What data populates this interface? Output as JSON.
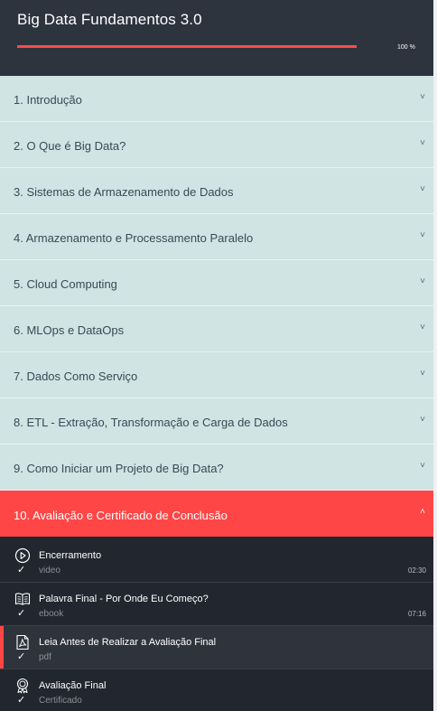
{
  "course": {
    "title": "Big Data Fundamentos 3.0",
    "progress_label": "100 %",
    "progress_fraction": 1.0
  },
  "sections": [
    {
      "label": "1. Introdução"
    },
    {
      "label": "2. O Que é Big Data?"
    },
    {
      "label": "3. Sistemas de Armazenamento de Dados"
    },
    {
      "label": "4. Armazenamento e Processamento Paralelo"
    },
    {
      "label": "5. Cloud Computing"
    },
    {
      "label": "6. MLOps e DataOps"
    },
    {
      "label": "7. Dados Como Serviço"
    },
    {
      "label": "8. ETL - Extração, Transformação e Carga de Dados"
    },
    {
      "label": "9. Como Iniciar um Projeto de Big Data?"
    },
    {
      "label": "10. Avaliação e Certificado de Conclusão"
    }
  ],
  "icons": {
    "chevron_down": "˅",
    "chevron_up": "˄",
    "check": "✓"
  },
  "lessons": [
    {
      "title": "Encerramento",
      "type": "video",
      "duration": "02:30",
      "icon": "play-circle-icon"
    },
    {
      "title": "Palavra Final - Por Onde Eu Começo?",
      "type": "ebook",
      "duration": "07:16",
      "icon": "book-icon"
    },
    {
      "title": "Leia Antes de Realizar a Avaliação Final",
      "type": "pdf",
      "duration": "",
      "icon": "pdf-icon"
    },
    {
      "title": "Avaliação Final",
      "type": "Certificado",
      "duration": "",
      "icon": "certificate-icon"
    }
  ],
  "colors": {
    "accent": "#ff4646",
    "section_bg": "#cfe4e3",
    "header_bg": "#2e343e",
    "lesson_bg": "#22262e"
  }
}
